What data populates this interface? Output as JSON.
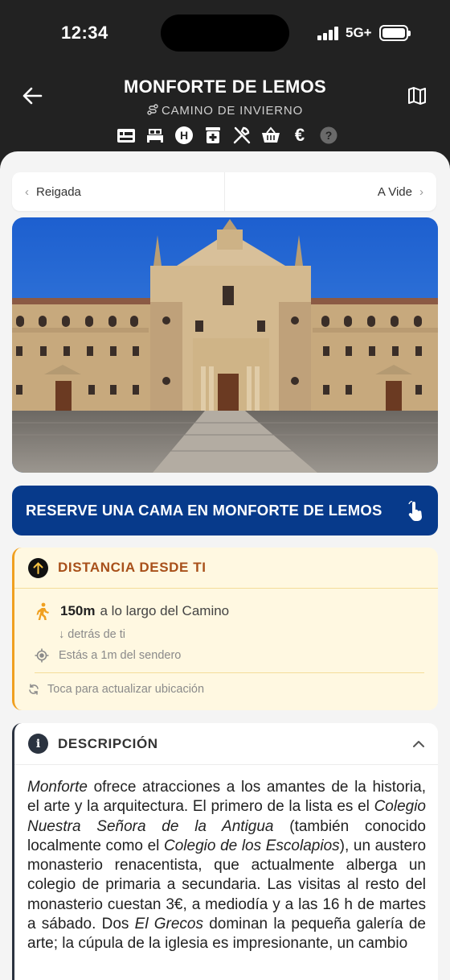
{
  "status_bar": {
    "time": "12:34",
    "network": "5G+",
    "battery_level": 1.0
  },
  "header": {
    "title": "MONFORTE DE LEMOS",
    "subtitle": "CAMINO DE INVIERNO",
    "amenity_icons": [
      "albergue-icon",
      "bed-icon",
      "hotel-icon",
      "pharmacy-icon",
      "restaurant-icon",
      "shop-icon",
      "atm-icon",
      "help-icon"
    ],
    "atm_symbol": "€",
    "hotel_symbol": "H",
    "help_symbol": "?"
  },
  "nav": {
    "prev_label": "Reigada",
    "next_label": "A Vide"
  },
  "book_button": {
    "label": "RESERVE UNA CAMA EN MONFORTE DE LEMOS"
  },
  "distance": {
    "title": "DISTANCIA DESDE TI",
    "distance_value": "150m",
    "distance_text": "a lo largo del Camino",
    "direction": "↓ detrás de ti",
    "off_trail": "Estás a 1m del sendero",
    "refresh": "Toca para actualizar ubicación"
  },
  "description": {
    "title": "DESCRIPCIÓN",
    "paragraph": [
      {
        "text": "Monforte",
        "italic": true
      },
      {
        "text": " ofrece atracciones a los amantes de la historia, el arte y la arquitectura. El primero de la lista es el ",
        "italic": false
      },
      {
        "text": "Colegio Nuestra Señora de la Antigua",
        "italic": true
      },
      {
        "text": " (también conocido localmente como el ",
        "italic": false
      },
      {
        "text": "Colegio de los Escolapios",
        "italic": true
      },
      {
        "text": "), un austero monasterio renacentista, que actualmente alberga un colegio de primaria a secundaria. Las visitas al resto del monasterio cuestan 3€, a mediodía y a las 16 h de martes a sábado. Dos ",
        "italic": false
      },
      {
        "text": "El Grecos",
        "italic": true
      },
      {
        "text": " dominan la pequeña galería de arte; la cúpula de la iglesia es impresionante, un cambio",
        "italic": false
      }
    ]
  },
  "colors": {
    "header_bg": "#222222",
    "book_button": "#073a8b",
    "distance_accent": "#f0a020",
    "distance_title": "#a8501a",
    "distance_bg": "#fff8e1"
  }
}
